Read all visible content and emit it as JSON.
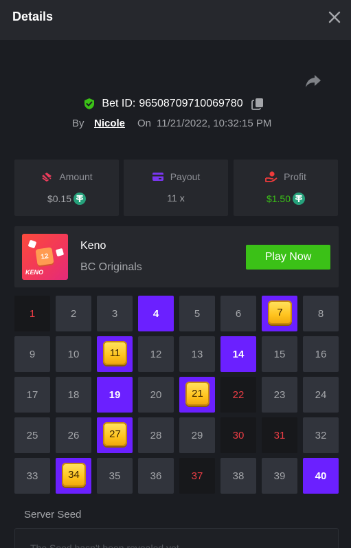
{
  "header": {
    "title": "Details"
  },
  "bet": {
    "id_label": "Bet ID:",
    "id": "96508709710069780",
    "by_label": "By",
    "user": "Nicole",
    "on_label": "On",
    "datetime": "11/21/2022, 10:32:15 PM"
  },
  "stats": {
    "amount": {
      "label": "Amount",
      "value": "$0.15"
    },
    "payout": {
      "label": "Payout",
      "value": "11 x"
    },
    "profit": {
      "label": "Profit",
      "value": "$1.50"
    }
  },
  "game": {
    "name": "Keno",
    "provider": "BC Originals",
    "play_label": "Play Now",
    "thumb_number": "12",
    "thumb_text": "KENO"
  },
  "keno": {
    "numbers": [
      "1",
      "2",
      "3",
      "4",
      "5",
      "6",
      "7",
      "8",
      "9",
      "10",
      "11",
      "12",
      "13",
      "14",
      "15",
      "16",
      "17",
      "18",
      "19",
      "20",
      "21",
      "22",
      "23",
      "24",
      "25",
      "26",
      "27",
      "28",
      "29",
      "30",
      "31",
      "32",
      "33",
      "34",
      "35",
      "36",
      "37",
      "38",
      "39",
      "40"
    ],
    "states": [
      "drawn",
      "none",
      "none",
      "picked",
      "none",
      "none",
      "hit",
      "none",
      "none",
      "none",
      "hit",
      "none",
      "none",
      "picked",
      "none",
      "none",
      "none",
      "none",
      "picked",
      "none",
      "hit",
      "drawn",
      "none",
      "none",
      "none",
      "none",
      "hit",
      "none",
      "none",
      "drawn",
      "drawn",
      "none",
      "none",
      "hit",
      "none",
      "none",
      "drawn",
      "none",
      "none",
      "picked"
    ]
  },
  "server_seed": {
    "label": "Server Seed",
    "text": "The Seed hasn't been revealed yet"
  },
  "colors": {
    "background": "#1b1d22",
    "panel": "#26282d",
    "cell": "#31343c",
    "picked": "#6b20ff",
    "drawn_text": "#ed3d45",
    "play_button": "#3bc117",
    "profit": "#3bc117",
    "shield": "#3bc117",
    "gem": "#ffc41f"
  },
  "icons": {
    "close": "close-icon",
    "share": "share-icon",
    "verified": "shield-check-icon",
    "copy": "copy-icon",
    "amount": "bet-chip-icon",
    "payout": "wallet-card-icon",
    "profit": "hand-coin-icon",
    "currency": "usdt-icon"
  }
}
